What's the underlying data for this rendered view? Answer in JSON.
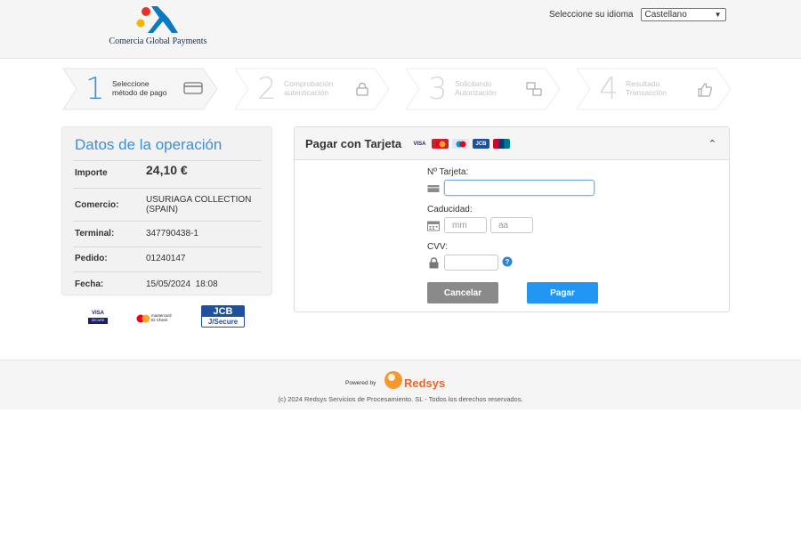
{
  "header": {
    "logo_text": "Comercia Global Payments",
    "language_label": "Seleccione su idioma",
    "language_value": "Castellano"
  },
  "steps": [
    {
      "number": "1",
      "line1": "Seleccione",
      "line2": "método de pago",
      "icon": "card-icon",
      "active": true
    },
    {
      "number": "2",
      "line1": "Comprobación",
      "line2": "autenticación",
      "icon": "lock-icon",
      "active": false
    },
    {
      "number": "3",
      "line1": "Solicitando",
      "line2": "Autorización",
      "icon": "transfer-icon",
      "active": false
    },
    {
      "number": "4",
      "line1": "Resultado",
      "line2": "Transacción",
      "icon": "thumbs-up-icon",
      "active": false
    }
  ],
  "operation": {
    "title": "Datos de la operación",
    "importe_label": "Importe",
    "importe_value": "24,10 €",
    "comercio_label": "Comercio:",
    "comercio_value": "USURIAGA COLLECTION (SPAIN)",
    "terminal_label": "Terminal:",
    "terminal_value": "347790438-1",
    "pedido_label": "Pedido:",
    "pedido_value": "01240147",
    "fecha_label": "Fecha:",
    "fecha_value": "15/05/2024  18:08"
  },
  "secure_brands": {
    "visa": "VISA",
    "visa_sub": "SECURE",
    "mastercard": "mastercard",
    "mastercard_sub": "ID Check",
    "jcb": "JCB",
    "jcb_sub": "J/Secure"
  },
  "card_form": {
    "title": "Pagar con Tarjeta",
    "brand_visa": "VISA",
    "brand_jcb": "JCB",
    "card_number_label": "Nº Tarjeta:",
    "card_number_value": "",
    "expiry_label": "Caducidad:",
    "expiry_month_placeholder": "mm",
    "expiry_year_placeholder": "aa",
    "cvv_label": "CVV:",
    "cvv_value": "",
    "cancel_label": "Cancelar",
    "pay_label": "Pagar"
  },
  "footer": {
    "powered_by": "Powered by",
    "redsys": "Redsys",
    "copyright": "(c) 2024 Redsys Servicios de Procesamiento. SL - Todos los derechos reservados."
  },
  "colors": {
    "accent": "#3d8fd8",
    "pay_button": "#2196f3",
    "cancel_button": "#8a8a8a",
    "redsys_orange": "#e8672a"
  }
}
